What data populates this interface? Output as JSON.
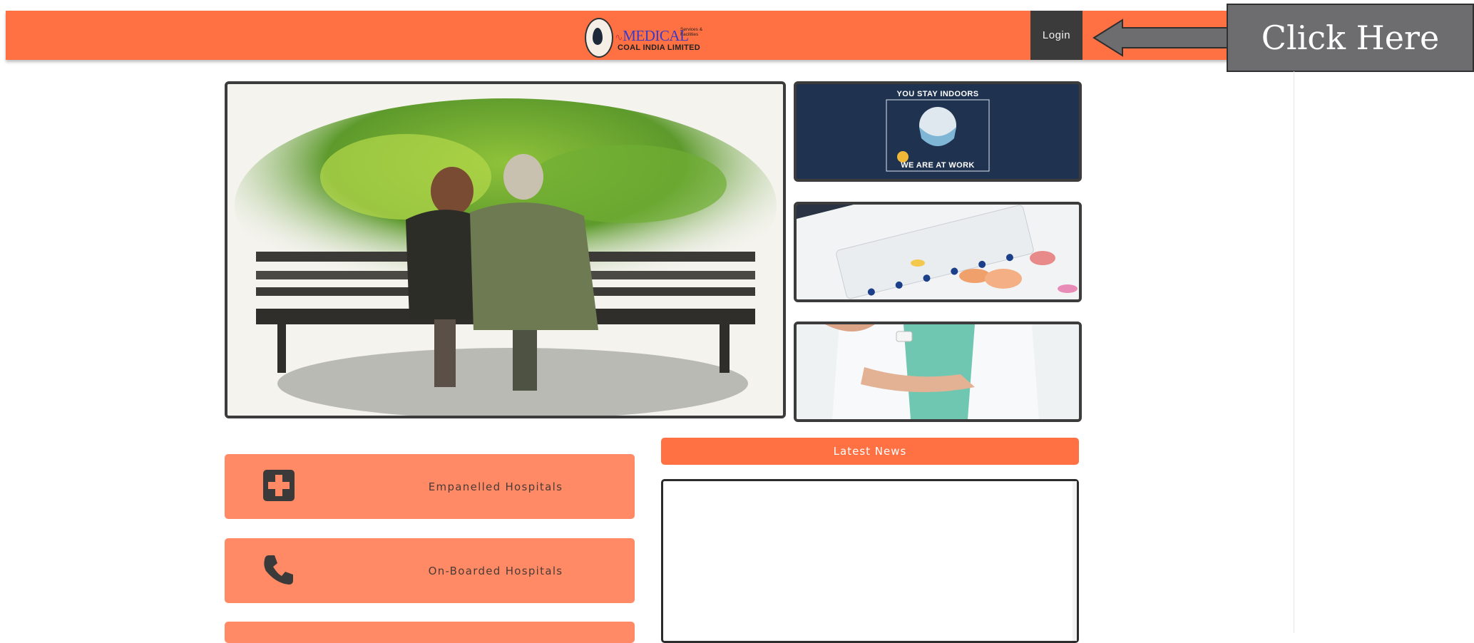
{
  "header": {
    "logo": {
      "brand_word": "MEDICAL",
      "small_line1": "Services",
      "small_line2": "Facilities",
      "small_amp": "&",
      "org_name": "COAL INDIA LIMITED"
    },
    "login_label": "Login"
  },
  "callout": {
    "label": "Click Here"
  },
  "posters": {
    "indoors_top": "YOU STAY INDOORS",
    "indoors_bottom": "WE ARE AT WORK"
  },
  "cards": [
    {
      "label": "Empanelled Hospitals",
      "icon": "hospital-plus-icon"
    },
    {
      "label": "On-Boarded Hospitals",
      "icon": "phone-icon"
    }
  ],
  "news": {
    "title": "Latest News"
  },
  "colors": {
    "header": "#ff7143",
    "card": "#ff8a65",
    "login_bg": "#3b3b3b",
    "callout_bg": "#6d6d6f"
  }
}
